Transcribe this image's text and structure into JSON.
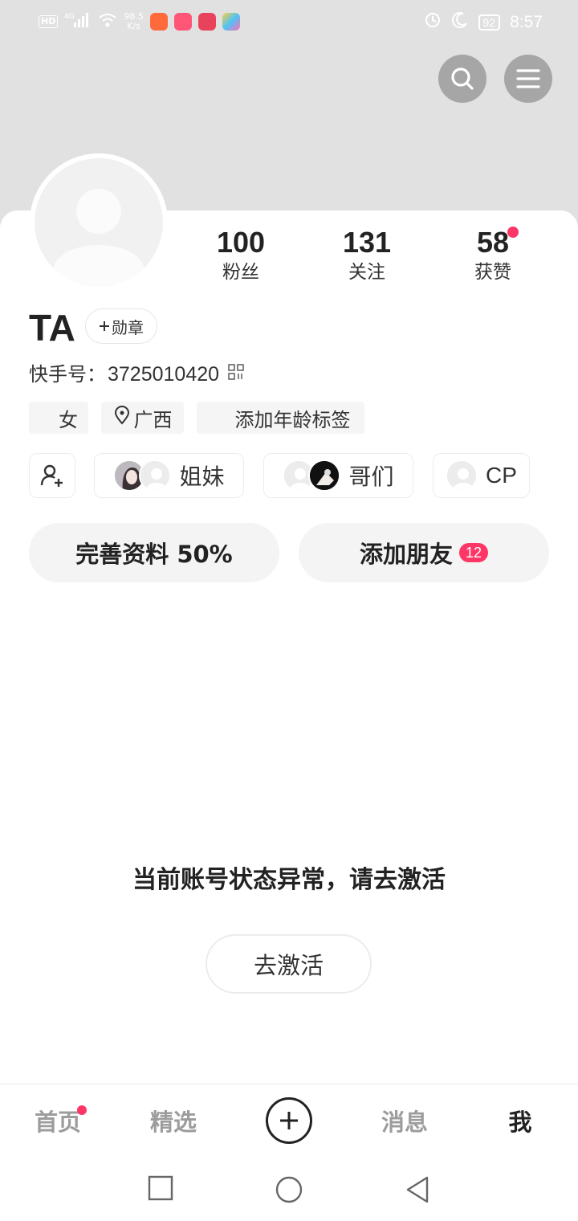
{
  "status_bar": {
    "network_chip": "HD",
    "signal_label": "4G",
    "speed": "98.5",
    "speed_unit": "K/s",
    "battery": "92",
    "time": "8:57"
  },
  "profile": {
    "name": "TA",
    "medal_button": "勋章",
    "kuaishou_id_label": "快手号：",
    "kuaishou_id": "3725010420",
    "stats": [
      {
        "value": "100",
        "label": "粉丝"
      },
      {
        "value": "131",
        "label": "关注"
      },
      {
        "value": "58",
        "label": "获赞"
      }
    ],
    "tags": [
      {
        "label": "女"
      },
      {
        "label": "广西"
      },
      {
        "label": "添加年龄标签"
      }
    ],
    "friend_groups": [
      {
        "label": "姐妹"
      },
      {
        "label": "哥们"
      },
      {
        "label": "CP"
      }
    ],
    "complete_profile": "完善资料 50%",
    "add_friends": "添加朋友",
    "add_friends_badge": "12"
  },
  "main": {
    "abnormal_message": "当前账号状态异常，请去激活",
    "activate_button": "去激活"
  },
  "bottom_nav": {
    "items": [
      {
        "label": "首页"
      },
      {
        "label": "精选"
      },
      {
        "label": "消息"
      },
      {
        "label": "我"
      }
    ]
  },
  "colors": {
    "accent": "#fe3666",
    "header_bg": "#e1e1e1",
    "pill_bg": "#f4f4f4"
  },
  "icons": [
    "search-icon",
    "menu-icon",
    "add-user-icon",
    "location-icon",
    "qr-code-icon",
    "plus-icon",
    "square-icon",
    "circle-icon",
    "back-triangle-icon"
  ]
}
